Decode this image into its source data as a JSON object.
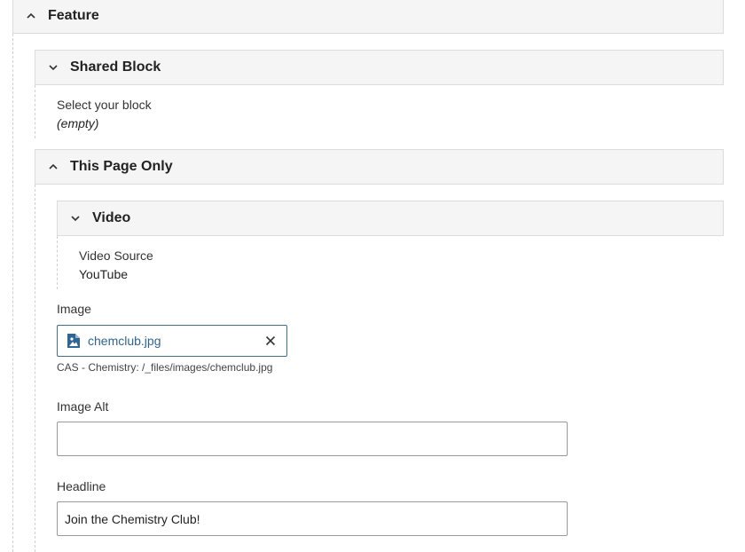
{
  "sections": {
    "feature": {
      "title": "Feature",
      "state": "expanded",
      "chevron": "chevron-up-icon"
    },
    "shared_block": {
      "title": "Shared Block",
      "state": "collapsed",
      "chevron": "chevron-down-icon"
    },
    "this_page_only": {
      "title": "This Page Only",
      "state": "expanded",
      "chevron": "chevron-up-icon"
    },
    "video": {
      "title": "Video",
      "state": "collapsed",
      "chevron": "chevron-down-icon"
    }
  },
  "shared_block_summary": {
    "label": "Select your block",
    "value": "(empty)"
  },
  "video_summary": {
    "label": "Video Source",
    "value": "YouTube"
  },
  "image": {
    "label": "Image",
    "file_name": "chemclub.jpg",
    "file_path": "CAS - Chemistry: /_files/images/chemclub.jpg",
    "file_icon": "image-file-icon",
    "clear_icon": "close-icon"
  },
  "image_alt": {
    "label": "Image Alt",
    "value": ""
  },
  "headline": {
    "label": "Headline",
    "value": "Join the Chemistry Club!"
  },
  "colors": {
    "header_bg": "#f5f5f5",
    "header_border": "#dcdcdc",
    "link_blue": "#2f6493",
    "chip_border": "#3d6f99"
  }
}
